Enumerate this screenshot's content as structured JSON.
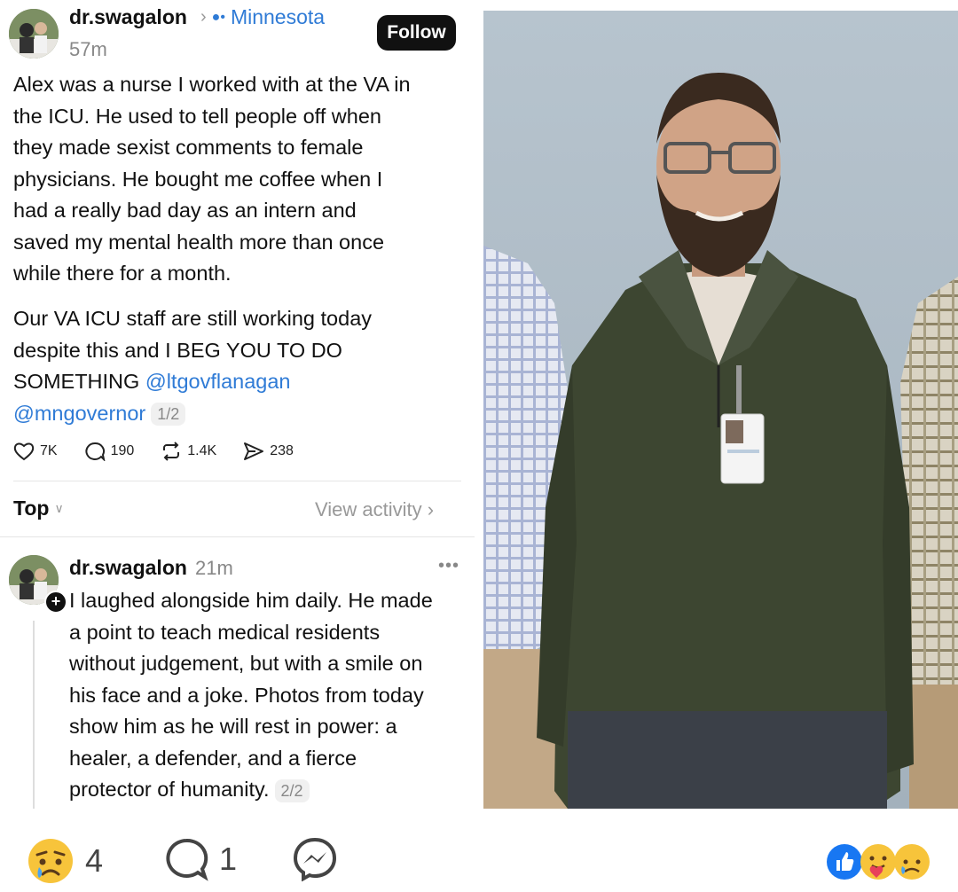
{
  "post": {
    "username": "dr.swagalon",
    "location": "Minnesota",
    "time": "57m",
    "follow_label": "Follow",
    "paragraph1": [
      "Alex was a nurse I worked with at the VA in",
      "the ICU. He used to tell people off when",
      "they made sexist comments to female",
      "physicians. He bought me coffee when I",
      "had a really bad day as an intern and",
      "saved my mental health more than once",
      "while there for a month."
    ],
    "paragraph2_lines": [
      "Our VA ICU staff are still working today",
      "despite this and I BEG YOU TO DO"
    ],
    "paragraph2_prefix": "SOMETHING ",
    "mention1": "@ltgovflanagan",
    "mention2": "@mngovernor",
    "counter": "1/2",
    "stats": {
      "likes": "7K",
      "replies": "190",
      "reposts": "1.4K",
      "shares": "238"
    }
  },
  "sort": {
    "label": "Top",
    "view_activity": "View activity ›"
  },
  "reply": {
    "username": "dr.swagalon",
    "time": "21m",
    "lines": [
      "I laughed alongside him daily. He made",
      "a point to teach medical residents",
      "without judgement, but with a smile on",
      "his face and a joke. Photos from today",
      "show him as he will rest in power: a",
      "healer, a defender, and a fierce"
    ],
    "last_line": "protector of humanity.",
    "counter": "2/2"
  },
  "footer": {
    "reaction_count": "4",
    "comment_count": "1"
  },
  "colors": {
    "link": "#2f7bd6",
    "follow_bg": "#111111",
    "fb_blue": "#1877f2",
    "shirt": "#3d4631",
    "wall": "#b9c6cf"
  },
  "icons": [
    "sad-emoji-icon",
    "comment-icon",
    "messenger-icon",
    "like-icon",
    "care-icon",
    "sad-icon",
    "heart-icon",
    "reply-icon",
    "repost-icon",
    "share-icon",
    "chevron-down-icon",
    "more-icon",
    "plus-icon",
    "location-icon"
  ]
}
